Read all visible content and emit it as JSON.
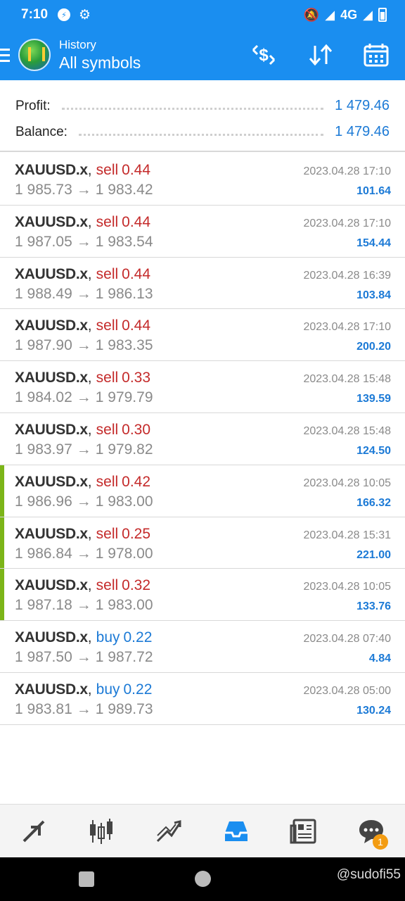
{
  "status_bar": {
    "time": "7:10",
    "network": "4G"
  },
  "header": {
    "small_title": "History",
    "big_title": "All symbols"
  },
  "summary": {
    "profit_label": "Profit:",
    "profit_value": "1 479.46",
    "balance_label": "Balance:",
    "balance_value": "1 479.46"
  },
  "deals": [
    {
      "symbol": "XAUUSD.x",
      "side": "sell",
      "volume": "0.44",
      "open": "1 985.73",
      "close": "1 983.42",
      "time": "2023.04.28 17:10",
      "profit": "101.64",
      "marked": false
    },
    {
      "symbol": "XAUUSD.x",
      "side": "sell",
      "volume": "0.44",
      "open": "1 987.05",
      "close": "1 983.54",
      "time": "2023.04.28 17:10",
      "profit": "154.44",
      "marked": false
    },
    {
      "symbol": "XAUUSD.x",
      "side": "sell",
      "volume": "0.44",
      "open": "1 988.49",
      "close": "1 986.13",
      "time": "2023.04.28 16:39",
      "profit": "103.84",
      "marked": false
    },
    {
      "symbol": "XAUUSD.x",
      "side": "sell",
      "volume": "0.44",
      "open": "1 987.90",
      "close": "1 983.35",
      "time": "2023.04.28 17:10",
      "profit": "200.20",
      "marked": false
    },
    {
      "symbol": "XAUUSD.x",
      "side": "sell",
      "volume": "0.33",
      "open": "1 984.02",
      "close": "1 979.79",
      "time": "2023.04.28 15:48",
      "profit": "139.59",
      "marked": false
    },
    {
      "symbol": "XAUUSD.x",
      "side": "sell",
      "volume": "0.30",
      "open": "1 983.97",
      "close": "1 979.82",
      "time": "2023.04.28 15:48",
      "profit": "124.50",
      "marked": false
    },
    {
      "symbol": "XAUUSD.x",
      "side": "sell",
      "volume": "0.42",
      "open": "1 986.96",
      "close": "1 983.00",
      "time": "2023.04.28 10:05",
      "profit": "166.32",
      "marked": true
    },
    {
      "symbol": "XAUUSD.x",
      "side": "sell",
      "volume": "0.25",
      "open": "1 986.84",
      "close": "1 978.00",
      "time": "2023.04.28 15:31",
      "profit": "221.00",
      "marked": true
    },
    {
      "symbol": "XAUUSD.x",
      "side": "sell",
      "volume": "0.32",
      "open": "1 987.18",
      "close": "1 983.00",
      "time": "2023.04.28 10:05",
      "profit": "133.76",
      "marked": true
    },
    {
      "symbol": "XAUUSD.x",
      "side": "buy",
      "volume": "0.22",
      "open": "1 987.50",
      "close": "1 987.72",
      "time": "2023.04.28 07:40",
      "profit": "4.84",
      "marked": false
    },
    {
      "symbol": "XAUUSD.x",
      "side": "buy",
      "volume": "0.22",
      "open": "1 983.81",
      "close": "1 989.73",
      "time": "2023.04.28 05:00",
      "profit": "130.24",
      "marked": false
    }
  ],
  "bottom_nav": {
    "items": [
      "quotes-icon",
      "chart-icon",
      "trade-icon",
      "history-icon",
      "news-icon",
      "chat-icon"
    ],
    "chat_badge": "1",
    "active": "history-icon"
  },
  "watermark": "@sudofi55",
  "colors": {
    "accent": "#1a8ef0",
    "sell": "#c42a2a",
    "buy": "#1c7ad6",
    "marker": "#7cb518"
  }
}
